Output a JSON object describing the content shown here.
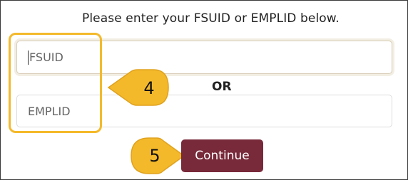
{
  "form": {
    "instruction": "Please enter your FSUID or EMPLID below.",
    "fsuid_placeholder": "FSUID",
    "or_label": "OR",
    "emplid_placeholder": "EMPLID",
    "continue_label": "Continue"
  },
  "annotations": {
    "step_fields": "4",
    "step_continue": "5",
    "highlight_color": "#f4b92b"
  },
  "colors": {
    "button_bg": "#782a3a",
    "button_text": "#ffffff"
  }
}
